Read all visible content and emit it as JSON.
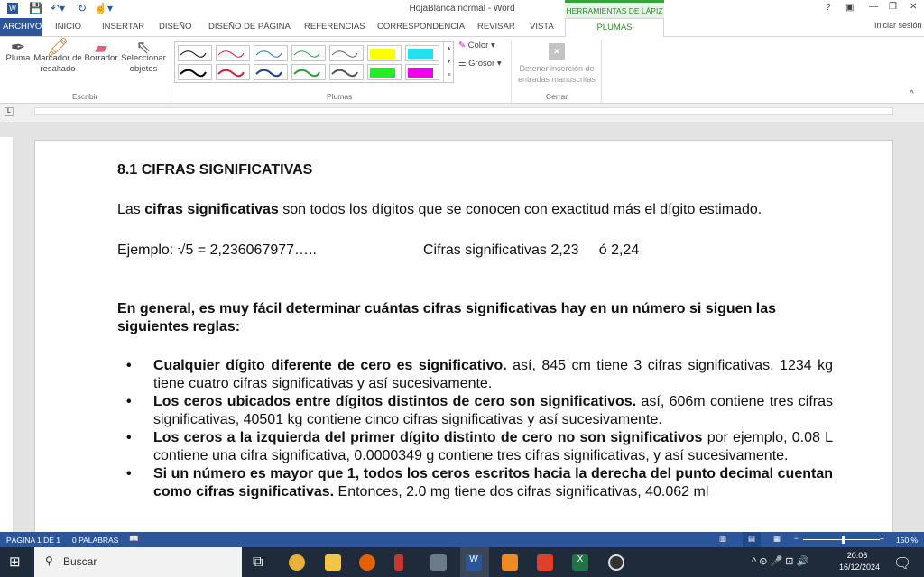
{
  "window": {
    "title": "HojaBlanca normal - Word",
    "help": "?",
    "signin": "Iniciar sesión"
  },
  "tabs": [
    "ARCHIVO",
    "INICIO",
    "INSERTAR",
    "DISEÑO",
    "DISEÑO DE PÁGINA",
    "REFERENCIAS",
    "CORRESPONDENCIA",
    "REVISAR",
    "VISTA"
  ],
  "context_tab": {
    "header": "HERRAMIENTAS DE LÁPIZ",
    "label": "PLUMAS"
  },
  "ribbon": {
    "escribir": {
      "label": "Escribir",
      "items": [
        "Pluma",
        "Marcador de resaltado",
        "Borrador",
        "Seleccionar objetos"
      ]
    },
    "plumas": {
      "label": "Plumas",
      "color": "Color",
      "grosor": "Grosor"
    },
    "cerrar": {
      "label": "Cerrar",
      "stop": "Detener inserción de entradas manuscritas"
    },
    "pen_colors": [
      "#000000",
      "#d0213a",
      "#2e6db5",
      "#2a9a3a",
      "#666666",
      "#ffff00",
      "#22e0ee",
      "#000000",
      "#d0213a",
      "#1f3f9a",
      "#2a9a3a",
      "#555555",
      "#22ee22",
      "#ee00ee"
    ]
  },
  "doc": {
    "heading": "8.1 CIFRAS SIGNIFICATIVAS",
    "intro_pre": "Las ",
    "intro_bold": "cifras significativas",
    "intro_post": " son todos los dígitos que se conocen con exactitud más el dígito estimado.",
    "example": "Ejemplo: √5 = 2,236067977…..",
    "example_right": "Cifras significativas 2,23     ó 2,24",
    "general": "En general, es muy fácil determinar cuántas cifras significativas hay en un número si siguen las siguientes reglas:",
    "rules": [
      {
        "bold": "Cualquier dígito diferente de cero es significativo.",
        "text": " así, 845 cm tiene 3 cifras significativas, 1234 kg tiene cuatro cifras significativas y así sucesivamente."
      },
      {
        "bold": "Los ceros ubicados entre dígitos distintos de cero son significativos.",
        "text": " así, 606m contiene tres cifras significativas, 40501 kg contiene cinco cifras significativas y así sucesivamente."
      },
      {
        "bold": "Los ceros a la izquierda del primer dígito distinto de cero no son significativos",
        "text": " por ejemplo, 0.08 L contiene una cifra significativa, 0.0000349 g contiene tres cifras significativas, y así sucesivamente."
      },
      {
        "bold": "Si un número es mayor que 1, todos los ceros escritos hacia la derecha del punto decimal cuentan como cifras significativas.",
        "text": " Entonces, 2.0 mg tiene dos cifras significativas, 40.062 ml"
      }
    ]
  },
  "status": {
    "page": "PÁGINA 1 DE 1",
    "words": "0 PALABRAS",
    "zoom": "150 %"
  },
  "taskbar": {
    "search": "Buscar",
    "time": "20:06",
    "date": "16/12/2024"
  }
}
